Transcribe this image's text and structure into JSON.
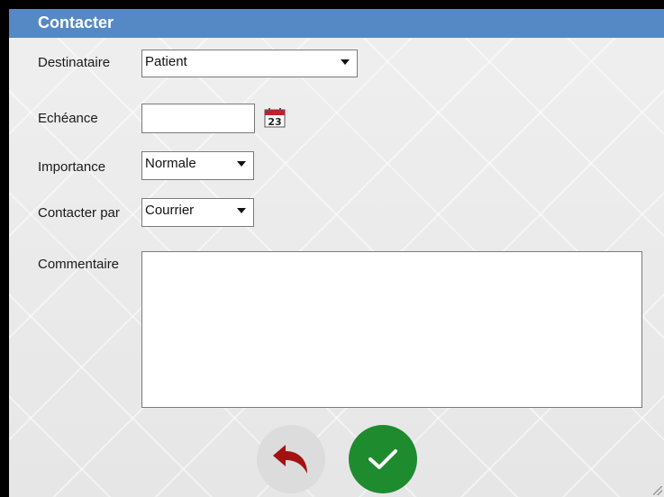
{
  "window": {
    "title": "Contacter"
  },
  "form": {
    "destinataire": {
      "label": "Destinataire",
      "value": "Patient"
    },
    "echeance": {
      "label": "Echéance",
      "value": "",
      "calendar_day": "23"
    },
    "importance": {
      "label": "Importance",
      "value": "Normale"
    },
    "contacter_par": {
      "label": "Contacter par",
      "value": "Courrier"
    },
    "commentaire": {
      "label": "Commentaire",
      "value": ""
    }
  },
  "buttons": {
    "back": {
      "icon": "undo-arrow-icon",
      "color": "#a31212"
    },
    "confirm": {
      "icon": "checkmark-icon",
      "color": "#1e8b2f"
    }
  },
  "colors": {
    "titlebar": "#5589c6"
  }
}
